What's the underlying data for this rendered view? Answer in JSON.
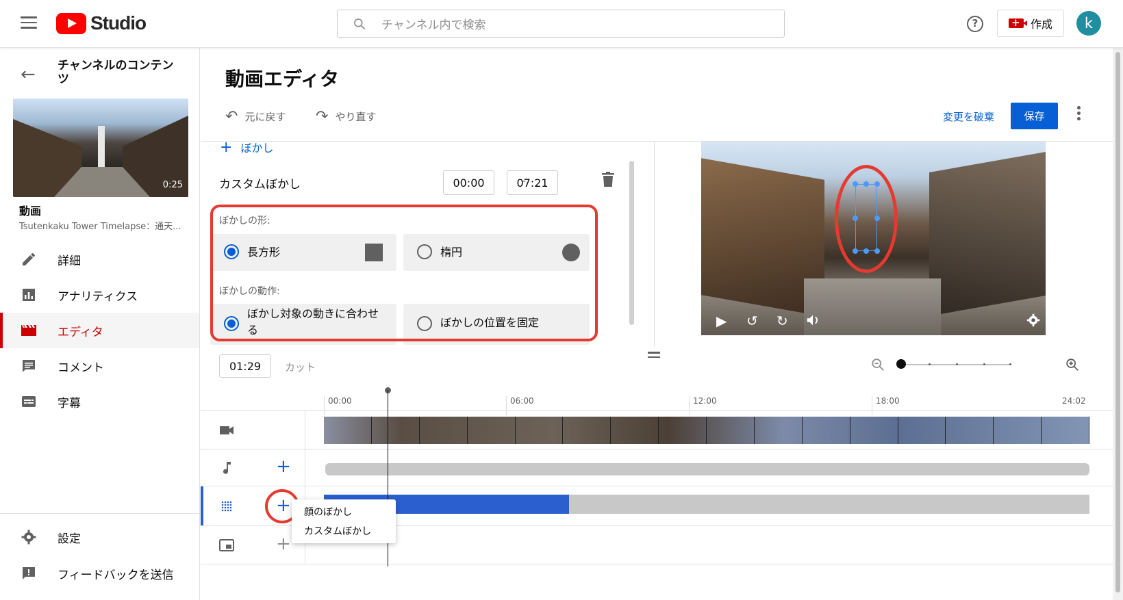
{
  "topbar": {
    "logo_text": "Studio",
    "search_placeholder": "チャンネル内で検索",
    "create_label": "作成",
    "avatar_letter": "k"
  },
  "sidebar": {
    "channel_title": "チャンネルのコンテンツ",
    "thumbnail_duration": "0:25",
    "video_label": "動画",
    "video_name": "Tsutenkaku Tower Timelapse：通天...",
    "nav": [
      {
        "label": "詳細",
        "icon": "pencil-icon"
      },
      {
        "label": "アナリティクス",
        "icon": "analytics-icon"
      },
      {
        "label": "エディタ",
        "icon": "clapperboard-icon",
        "active": true
      },
      {
        "label": "コメント",
        "icon": "comment-icon"
      },
      {
        "label": "字幕",
        "icon": "subtitles-icon"
      }
    ],
    "bottom": [
      {
        "label": "設定",
        "icon": "gear-icon"
      },
      {
        "label": "フィードバックを送信",
        "icon": "feedback-icon"
      }
    ]
  },
  "editor": {
    "title": "動画エディタ",
    "undo_label": "元に戻す",
    "redo_label": "やり直す",
    "discard_label": "変更を破棄",
    "save_label": "保存"
  },
  "blur_panel": {
    "add_label": "ぼかし",
    "custom_label": "カスタムぼかし",
    "start_time": "00:00",
    "end_time": "07:21",
    "shape_heading": "ぼかしの形:",
    "shape_options": [
      "長方形",
      "楕円"
    ],
    "shape_selected": "長方形",
    "motion_heading": "ぼかしの動作:",
    "motion_options": [
      "ぼかし対象の動きに合わせる",
      "ぼかしの位置を固定"
    ],
    "motion_selected": "ぼかし対象の動きに合わせる"
  },
  "timeline": {
    "current_time": "01:29",
    "cut_label": "カット",
    "ruler": [
      "00:00",
      "06:00",
      "12:00",
      "18:00",
      "24:02"
    ],
    "blur_track_fill": 0.32,
    "add_menu": [
      "顔のぼかし",
      "カスタムぼかし"
    ]
  },
  "colors": {
    "brand_red": "#ff0000",
    "accent_blue": "#065fd4",
    "annotation_red": "#e53a2f"
  }
}
